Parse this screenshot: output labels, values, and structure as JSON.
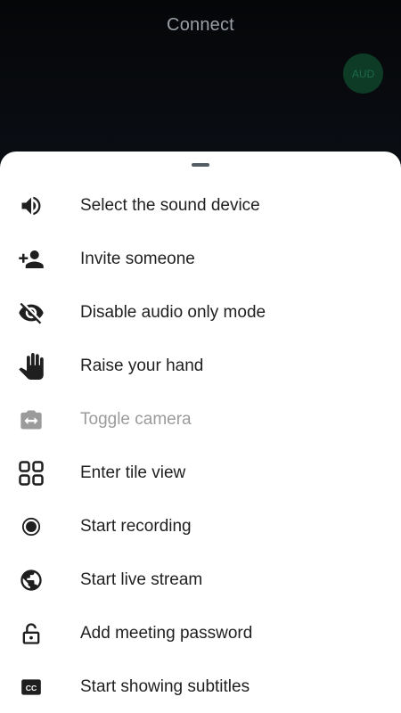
{
  "header": {
    "title": "Connect",
    "avatar_text": "AUD"
  },
  "colors": {
    "sheet_background": "#ffffff",
    "icon": "#1f1f1f",
    "disabled": "#9b9b9b",
    "avatar_bg": "#0e3b26"
  },
  "menu": {
    "items": [
      {
        "label": "Select the sound device",
        "icon": "speaker-icon",
        "enabled": true
      },
      {
        "label": "Invite someone",
        "icon": "add-person-icon",
        "enabled": true
      },
      {
        "label": "Disable audio only mode",
        "icon": "eye-off-icon",
        "enabled": true
      },
      {
        "label": "Raise your hand",
        "icon": "hand-icon",
        "enabled": true
      },
      {
        "label": "Toggle camera",
        "icon": "switch-camera-icon",
        "enabled": false
      },
      {
        "label": "Enter tile view",
        "icon": "tile-view-icon",
        "enabled": true
      },
      {
        "label": "Start recording",
        "icon": "record-icon",
        "enabled": true
      },
      {
        "label": "Start live stream",
        "icon": "globe-icon",
        "enabled": true
      },
      {
        "label": "Add meeting password",
        "icon": "lock-open-icon",
        "enabled": true
      },
      {
        "label": "Start showing subtitles",
        "icon": "closed-captions-icon",
        "enabled": true
      }
    ]
  }
}
